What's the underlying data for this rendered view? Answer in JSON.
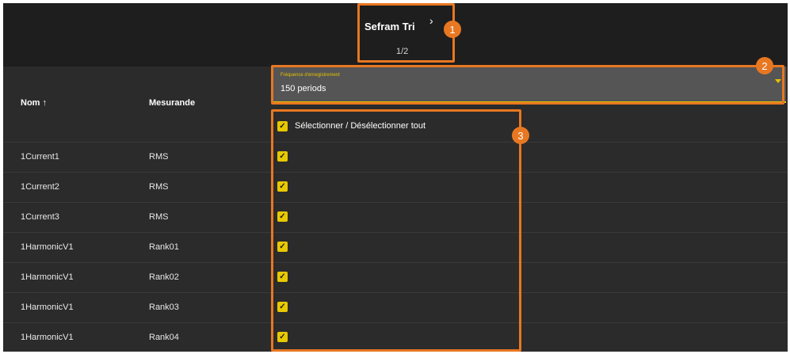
{
  "header": {
    "device_name": "Sefram Tri",
    "page_indicator": "1/2"
  },
  "frequency_field": {
    "label": "Fréquence d'enregistrement",
    "value": "150 periods"
  },
  "table": {
    "col_name": "Nom ↑",
    "col_measurand": "Mesurande",
    "select_all_label": "Sélectionner / Désélectionner tout",
    "select_all_checked": true,
    "rows": [
      {
        "name": "1Current1",
        "measurand": "RMS",
        "checked": true
      },
      {
        "name": "1Current2",
        "measurand": "RMS",
        "checked": true
      },
      {
        "name": "1Current3",
        "measurand": "RMS",
        "checked": true
      },
      {
        "name": "1HarmonicV1",
        "measurand": "Rank01",
        "checked": true
      },
      {
        "name": "1HarmonicV1",
        "measurand": "Rank02",
        "checked": true
      },
      {
        "name": "1HarmonicV1",
        "measurand": "Rank03",
        "checked": true
      },
      {
        "name": "1HarmonicV1",
        "measurand": "Rank04",
        "checked": true
      }
    ]
  },
  "callouts": [
    {
      "number": "1"
    },
    {
      "number": "2"
    },
    {
      "number": "3"
    }
  ],
  "colors": {
    "accent": "#e6c300",
    "callout": "#e87722",
    "background": "#2b2b2b",
    "topbar": "#1e1e1e"
  },
  "icons": {
    "next": "chevron-right-icon",
    "dropdown": "caret-down-icon",
    "checkbox": "checkbox-checked-icon"
  }
}
